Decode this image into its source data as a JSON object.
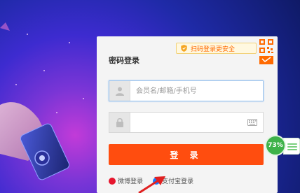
{
  "login": {
    "title": "密码登录",
    "qr_banner_text": "扫码登录更安全",
    "username_placeholder": "会员名/邮箱/手机号",
    "password_placeholder": "",
    "submit_label": "登 录",
    "alt_logins": [
      {
        "label": "微博登录",
        "icon": "weibo-icon",
        "color": "#e6162d"
      },
      {
        "label": "支付宝登录",
        "icon": "alipay-icon",
        "color": "#1677ff"
      }
    ]
  },
  "speed_widget": {
    "percent": "73%"
  },
  "colors": {
    "accent": "#ff4d0f",
    "banner_text": "#ff6a00",
    "widget_green": "#3fb24a"
  }
}
